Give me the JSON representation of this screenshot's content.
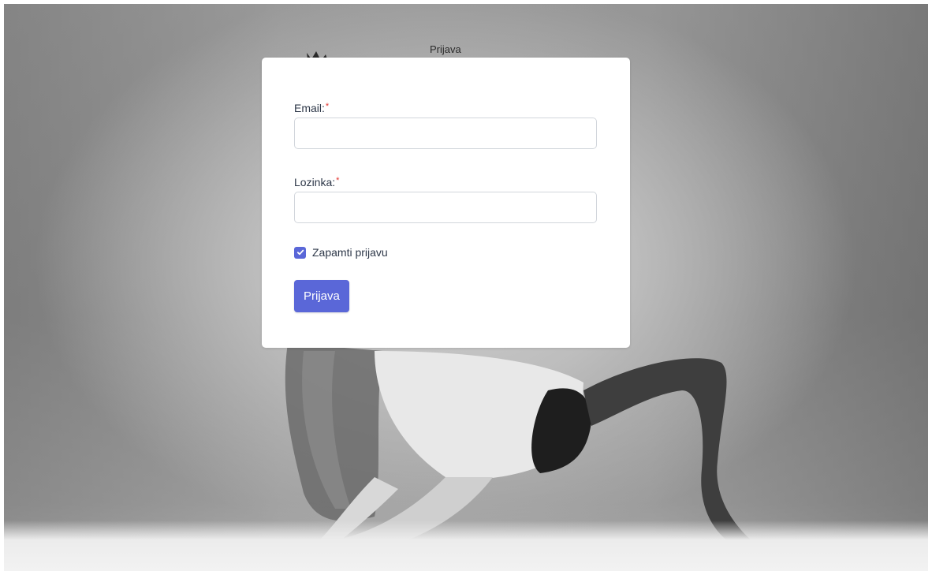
{
  "header": {
    "label": "Prijava"
  },
  "form": {
    "email_label": "Email:",
    "email_required_mark": "*",
    "email_value": "",
    "password_label": "Lozinka:",
    "password_required_mark": "*",
    "password_value": "",
    "remember_label": "Zapamti prijavu",
    "remember_checked": true,
    "submit_label": "Prijava"
  },
  "colors": {
    "accent": "#5a67d8",
    "required": "#e3342f"
  },
  "icons": {
    "checkbox": "check-icon",
    "logo": "hand-logo-icon"
  }
}
